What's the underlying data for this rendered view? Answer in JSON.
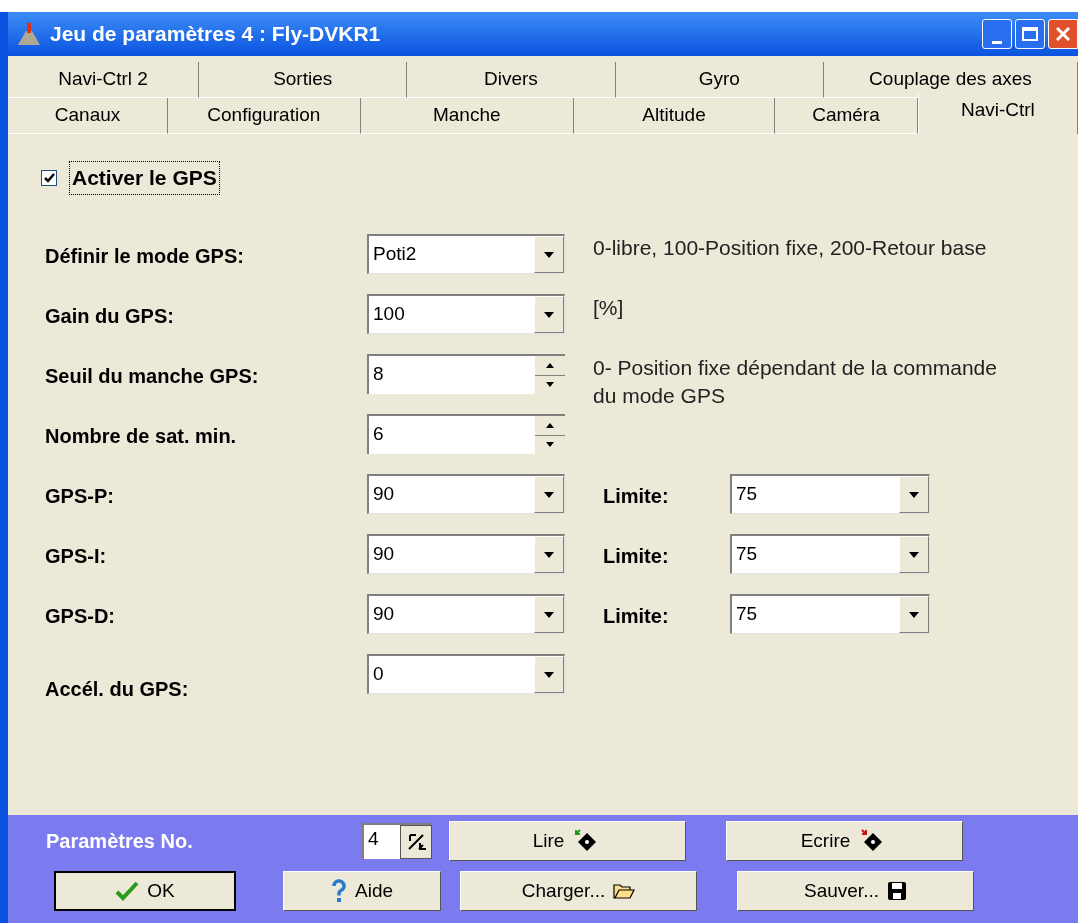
{
  "window": {
    "title": "Jeu de paramètres 4 : Fly-DVKR1"
  },
  "tab_rows": [
    [
      {
        "label": "Navi-Ctrl 2",
        "selected": false
      },
      {
        "label": "Sorties",
        "selected": false
      },
      {
        "label": "Divers",
        "selected": false
      },
      {
        "label": "Gyro",
        "selected": false
      },
      {
        "label": "Couplage des axes",
        "selected": false
      }
    ],
    [
      {
        "label": "Canaux",
        "selected": false
      },
      {
        "label": "Configuration",
        "selected": false
      },
      {
        "label": "Manche",
        "selected": false
      },
      {
        "label": "Altitude",
        "selected": false
      },
      {
        "label": "Caméra",
        "selected": false
      },
      {
        "label": "Navi-Ctrl",
        "selected": true
      }
    ]
  ],
  "enable_gps": {
    "label": "Activer le GPS",
    "checked": true
  },
  "rows": [
    {
      "label": "Définir le mode GPS:",
      "kind": "combo",
      "value": "Poti2",
      "note": "0-libre, 100-Position fixe, 200-Retour base"
    },
    {
      "label": "Gain du GPS:",
      "kind": "combo",
      "value": "100",
      "note": "[%]"
    },
    {
      "label": "Seuil du manche GPS:",
      "kind": "spin",
      "value": "8",
      "note": "0- Position fixe dépendant de la commande du mode GPS"
    },
    {
      "label": "Nombre de sat. min.",
      "kind": "spin",
      "value": "6"
    },
    {
      "label": "GPS-P:",
      "kind": "combo",
      "value": "90",
      "limit": {
        "label": "Limite:",
        "value": "75"
      }
    },
    {
      "label": "GPS-I:",
      "kind": "combo",
      "value": "90",
      "limit": {
        "label": "Limite:",
        "value": "75"
      }
    },
    {
      "label": "GPS-D:",
      "kind": "combo",
      "value": "90",
      "limit": {
        "label": "Limite:",
        "value": "75"
      }
    },
    {
      "label": "Accél. du GPS:",
      "kind": "combo",
      "value": "0"
    }
  ],
  "footer": {
    "param_label": "Paramètres No.",
    "param_value": "4",
    "buttons": [
      {
        "label": "Lire",
        "kind": "read"
      },
      {
        "label": "Ecrire",
        "kind": "write"
      },
      {
        "label": "OK",
        "kind": "ok"
      },
      {
        "label": "Aide",
        "kind": "help"
      },
      {
        "label": "Charger...",
        "kind": "load"
      },
      {
        "label": "Sauver...",
        "kind": "save"
      }
    ]
  }
}
